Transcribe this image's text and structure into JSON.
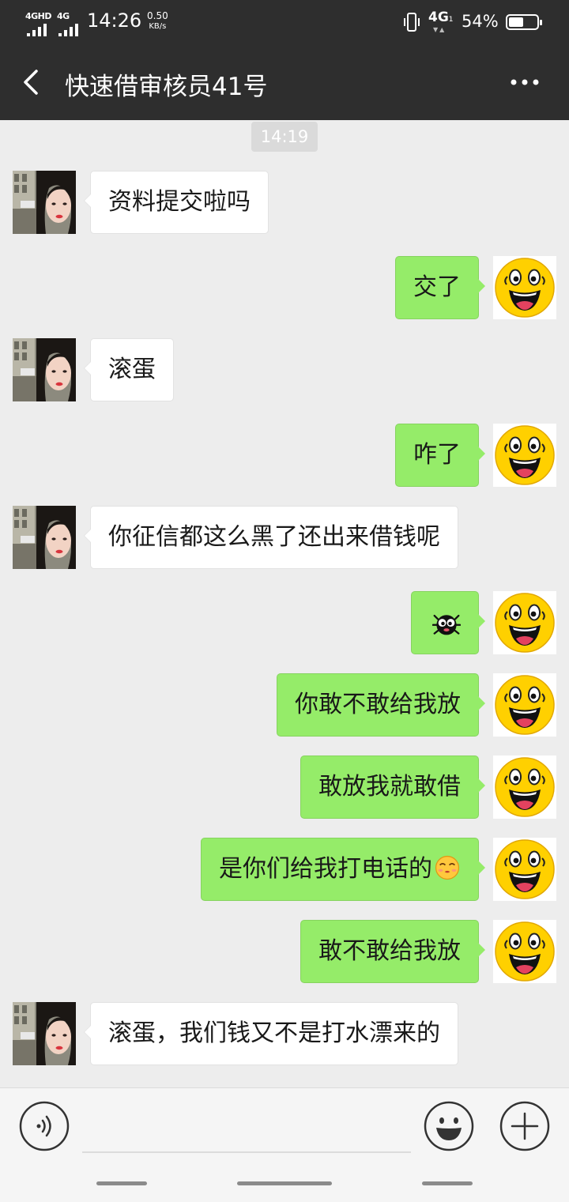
{
  "status_bar": {
    "sim1_label": "4GHD",
    "sim2_label": "4G",
    "time": "14:26",
    "speed_value": "0.50",
    "speed_unit": "KB/s",
    "network": "4G",
    "network_sub": "1",
    "battery_percent": "54%",
    "battery_level": 0.54
  },
  "header": {
    "back_icon": "chevron-left-icon",
    "title": "快速借审核员41号",
    "more_icon": "more-horizontal-icon"
  },
  "chat": {
    "timestamp": "14:19",
    "messages": [
      {
        "from": "them",
        "text": "资料提交啦吗"
      },
      {
        "from": "me",
        "text": "交了"
      },
      {
        "from": "them",
        "text": "滚蛋"
      },
      {
        "from": "me",
        "text": "咋了"
      },
      {
        "from": "them",
        "text": "你征信都这么黑了还出来借钱呢"
      },
      {
        "from": "me",
        "text": "",
        "emoji": "bug-emoji"
      },
      {
        "from": "me",
        "text": "你敢不敢给我放"
      },
      {
        "from": "me",
        "text": "敢放我就敢借"
      },
      {
        "from": "me",
        "text": "是你们给我打电话的",
        "emoji": "kissing-face-emoji"
      },
      {
        "from": "me",
        "text": "敢不敢给我放"
      },
      {
        "from": "them",
        "text": "滚蛋，我们钱又不是打水漂来的"
      }
    ]
  },
  "input_bar": {
    "voice_icon": "voice-icon",
    "input_value": "",
    "emoji_icon": "smile-icon",
    "plus_icon": "plus-icon"
  },
  "colors": {
    "header_bg": "#2e2e2e",
    "chat_bg": "#ededed",
    "my_bubble": "#95ec69",
    "their_bubble": "#ffffff"
  }
}
